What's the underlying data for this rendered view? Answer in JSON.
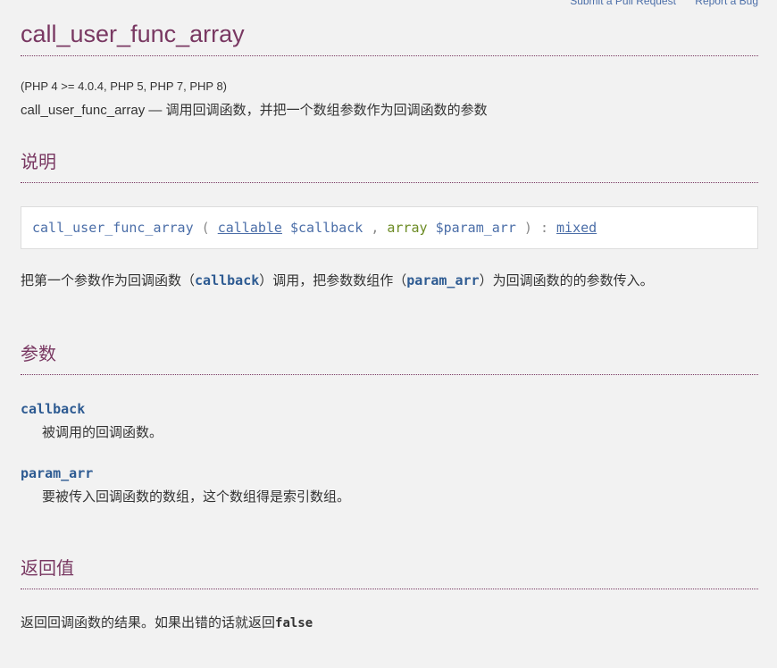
{
  "top_links": {
    "pull_request": "Submit a Pull Request",
    "report_bug": "Report a Bug"
  },
  "title": "call_user_func_array",
  "versions": "(PHP 4 >= 4.0.4, PHP 5, PHP 7, PHP 8)",
  "refpurpose": "call_user_func_array — 调用回调函数，并把一个数组参数作为回调函数的参数",
  "description": {
    "heading": "说明",
    "synopsis": {
      "function": "call_user_func_array",
      "open_paren": "(",
      "param1_type": "callable",
      "param1_name": "$callback",
      "comma": ",",
      "param2_type": "array",
      "param2_name": "$param_arr",
      "close_paren": ")",
      "colon": ":",
      "return_type": "mixed"
    },
    "text_before": "把第一个参数作为回调函数（",
    "text_code1": "callback",
    "text_middle": "）调用，把参数数组作（",
    "text_code2": "param_arr",
    "text_after": "）为回调函数的的参数传入。"
  },
  "parameters": {
    "heading": "参数",
    "items": [
      {
        "term": "callback",
        "definition": "被调用的回调函数。"
      },
      {
        "term": "param_arr",
        "definition": "要被传入回调函数的数组，这个数组得是索引数组。"
      }
    ]
  },
  "return_values": {
    "heading": "返回值",
    "text_before": "返回回调函数的结果。如果出错的话就返回",
    "literal": "false"
  },
  "colors": {
    "heading": "#793862",
    "link": "#4b6ea8",
    "param": "#2e5b92",
    "array_type": "#6c8b24",
    "background": "#f2f2f2"
  }
}
